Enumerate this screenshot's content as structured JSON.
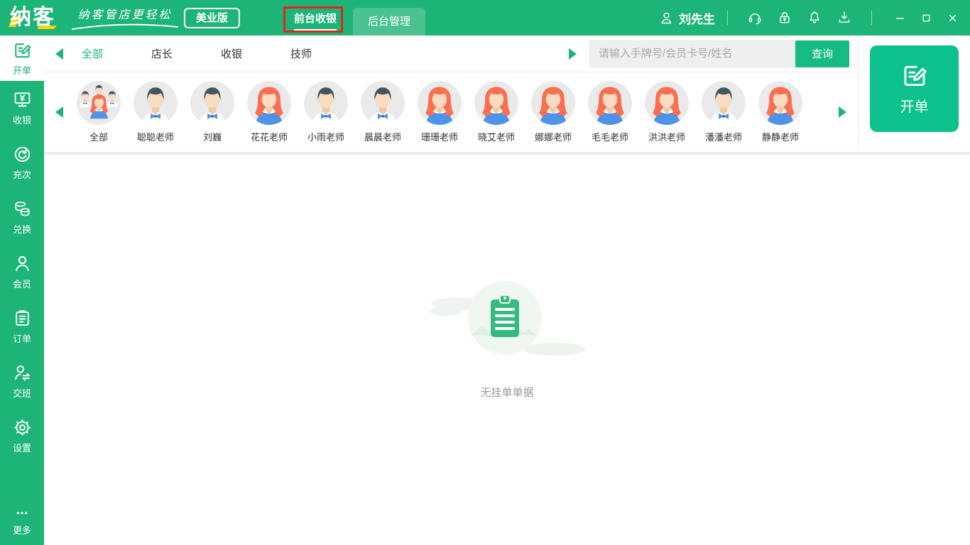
{
  "colors": {
    "header_green": "#1db478",
    "light_tab_green": "#4bc292",
    "accent_button_green": "#0cc18b",
    "search_button_green": "#15bb83",
    "annotation_red": "#e0251b",
    "logo_accent_yellow": "#ffd100",
    "text_dark": "#333333",
    "text_gray": "#9a9a9a"
  },
  "header": {
    "logo": "纳客",
    "slogan": "纳客管店更轻松",
    "edition": "美业版",
    "nav_tabs": [
      {
        "label": "前台收银",
        "active": true,
        "annotated": true
      },
      {
        "label": "后台管理",
        "active": false
      }
    ],
    "user": {
      "icon": "user-icon",
      "name": "刘先生"
    },
    "tool_icons": [
      {
        "icon": "headset-icon"
      },
      {
        "icon": "lock-icon"
      },
      {
        "icon": "bell-icon"
      },
      {
        "icon": "download-icon"
      }
    ],
    "window_controls": [
      {
        "icon": "minimize-icon"
      },
      {
        "icon": "maximize-icon"
      },
      {
        "icon": "close-icon"
      }
    ]
  },
  "sidebar": {
    "items": [
      {
        "label": "开单",
        "icon": "bill-icon",
        "active": true
      },
      {
        "label": "收银",
        "icon": "cashier-icon"
      },
      {
        "label": "充次",
        "icon": "recharge-icon"
      },
      {
        "label": "兑换",
        "icon": "exchange-icon"
      },
      {
        "label": "会员",
        "icon": "member-icon"
      },
      {
        "label": "订单",
        "icon": "order-icon"
      },
      {
        "label": "交班",
        "icon": "shift-icon"
      },
      {
        "label": "设置",
        "icon": "settings-icon"
      },
      {
        "label": "更多",
        "icon": "more-icon",
        "pinned_bottom": true
      }
    ]
  },
  "role_tabs": {
    "items": [
      {
        "label": "全部",
        "active": true
      },
      {
        "label": "店长",
        "active": false
      },
      {
        "label": "收银",
        "active": false
      },
      {
        "label": "技师",
        "active": false
      }
    ]
  },
  "search": {
    "placeholder": "请输入手牌号/会员卡号/姓名",
    "button_label": "查询"
  },
  "staff": [
    {
      "name": "全部",
      "avatar": "group"
    },
    {
      "name": "聪聪老师",
      "avatar": "male"
    },
    {
      "name": "刘巍",
      "avatar": "male"
    },
    {
      "name": "花花老师",
      "avatar": "female"
    },
    {
      "name": "小雨老师",
      "avatar": "male"
    },
    {
      "name": "晨晨老师",
      "avatar": "male"
    },
    {
      "name": "珊珊老师",
      "avatar": "female"
    },
    {
      "name": "晓艾老师",
      "avatar": "female"
    },
    {
      "name": "娜娜老师",
      "avatar": "female"
    },
    {
      "name": "毛毛老师",
      "avatar": "female"
    },
    {
      "name": "洪洪老师",
      "avatar": "female"
    },
    {
      "name": "潘潘老师",
      "avatar": "male"
    },
    {
      "name": "静静老师",
      "avatar": "female"
    }
  ],
  "action_panel": {
    "label": "开单",
    "icon": "bill-icon"
  },
  "empty_state": {
    "icon": "clipboard-illustration",
    "text": "无挂单单据"
  }
}
